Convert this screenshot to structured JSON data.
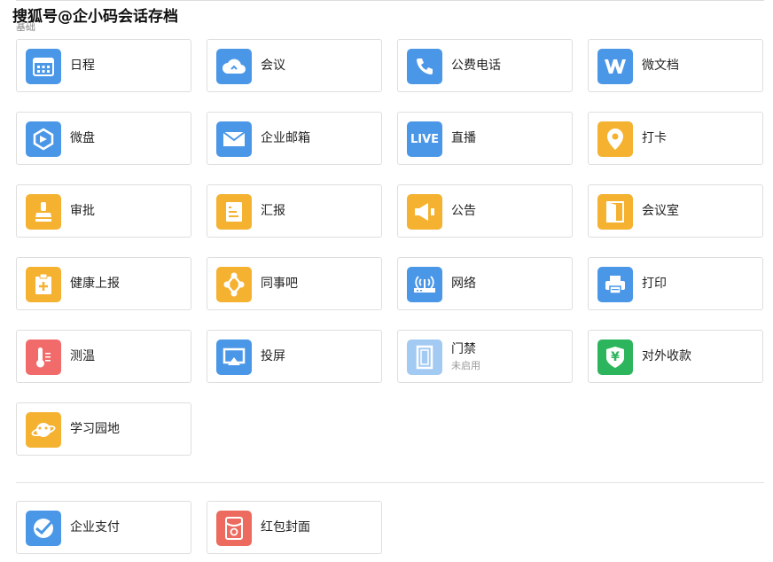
{
  "watermark": "搜狐号@企小码会话存档",
  "section": {
    "label": "基础"
  },
  "colors": {
    "blue": "#4a97e8",
    "orange": "#f5b130",
    "red": "#f26b6b",
    "green": "#2db55d",
    "salmon": "#ec6b5e"
  },
  "apps": [
    {
      "label": "日程",
      "icon": "calendar-icon"
    },
    {
      "label": "会议",
      "icon": "cloud-meeting-icon"
    },
    {
      "label": "公费电话",
      "icon": "phone-icon"
    },
    {
      "label": "微文档",
      "icon": "w-doc-icon"
    },
    {
      "label": "微盘",
      "icon": "drive-icon"
    },
    {
      "label": "企业邮箱",
      "icon": "mail-icon"
    },
    {
      "label": "直播",
      "icon": "live-icon",
      "icon_text": "LIVE"
    },
    {
      "label": "打卡",
      "icon": "location-pin-icon"
    },
    {
      "label": "审批",
      "icon": "stamp-icon"
    },
    {
      "label": "汇报",
      "icon": "report-icon"
    },
    {
      "label": "公告",
      "icon": "megaphone-icon"
    },
    {
      "label": "会议室",
      "icon": "door-icon"
    },
    {
      "label": "健康上报",
      "icon": "health-report-icon"
    },
    {
      "label": "同事吧",
      "icon": "colleague-network-icon"
    },
    {
      "label": "网络",
      "icon": "router-icon"
    },
    {
      "label": "打印",
      "icon": "printer-icon"
    },
    {
      "label": "测温",
      "icon": "thermometer-icon"
    },
    {
      "label": "投屏",
      "icon": "screen-cast-icon"
    },
    {
      "label": "门禁",
      "icon": "access-door-icon",
      "status": "未启用"
    },
    {
      "label": "对外收款",
      "icon": "yuan-shield-icon",
      "icon_text": "¥"
    },
    {
      "label": "学习园地",
      "icon": "planet-icon"
    }
  ],
  "extra": [
    {
      "label": "企业支付",
      "icon": "payment-icon"
    },
    {
      "label": "红包封面",
      "icon": "red-packet-icon"
    }
  ]
}
